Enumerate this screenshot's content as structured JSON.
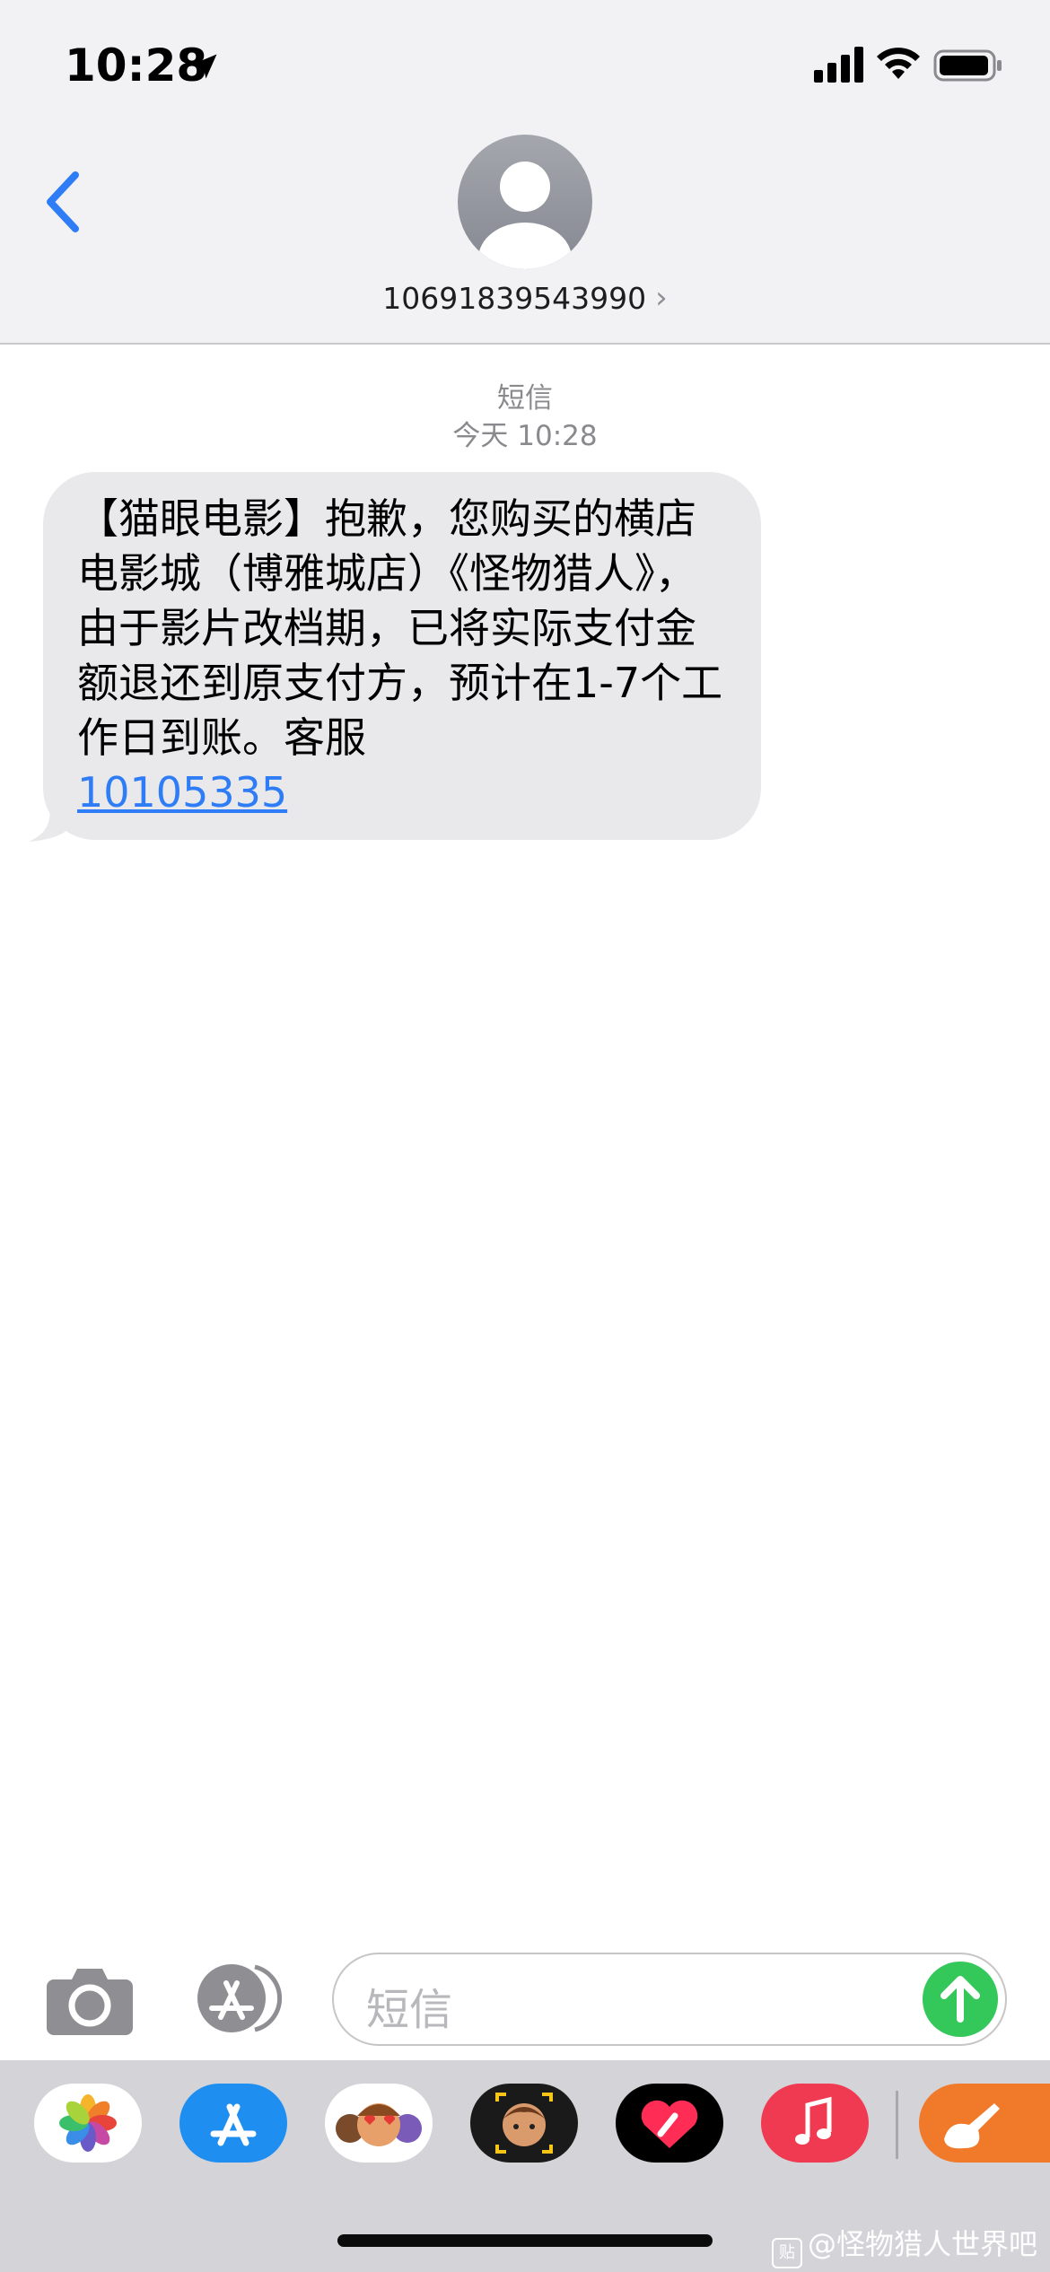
{
  "status_bar": {
    "time": "10:28"
  },
  "header": {
    "contact_number": "10691839543990",
    "chevron": "›"
  },
  "conversation": {
    "service_label": "短信",
    "timestamp": "今天 10:28",
    "message": {
      "text": "【猫眼电影】抱歉，您购买的横店电影城（博雅城店）《怪物猎人》，由于影片改档期，已将实际支付金额退还到原支付方，预计在1-7个工作日到账。客服",
      "link": "10105335"
    }
  },
  "input": {
    "placeholder": "短信"
  },
  "tray": {
    "apps": [
      "photos-icon",
      "app-store-icon",
      "memoji-stickers-icon",
      "animoji-icon",
      "digital-touch-icon",
      "music-icon",
      "garageband-icon"
    ]
  },
  "watermark": {
    "badge": "贴",
    "text": "@怪物猎人世界吧"
  },
  "colors": {
    "accent": "#2f7df6",
    "bubble": "#e9e9eb",
    "send": "#34c759"
  }
}
